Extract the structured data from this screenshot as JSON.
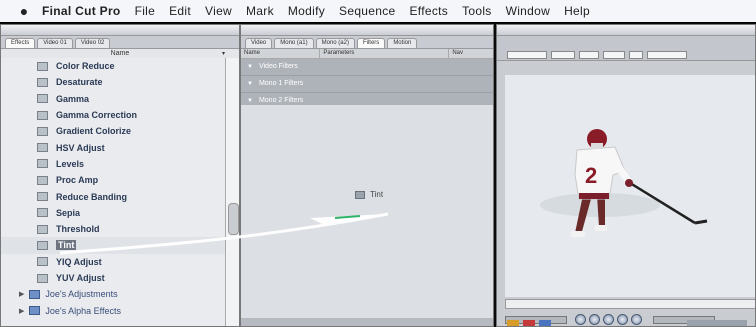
{
  "menubar": {
    "apple": "",
    "items": [
      "Final Cut Pro",
      "File",
      "Edit",
      "View",
      "Mark",
      "Modify",
      "Sequence",
      "Effects",
      "Tools",
      "Window",
      "Help"
    ]
  },
  "browser": {
    "tabs": [
      "Effects",
      "Video 01",
      "Video 02"
    ],
    "column_name": "Name",
    "filters": [
      "Color Reduce",
      "Desaturate",
      "Gamma",
      "Gamma Correction",
      "Gradient Colorize",
      "HSV Adjust",
      "Levels",
      "Proc Amp",
      "Reduce Banding",
      "Sepia",
      "Threshold",
      "Tint",
      "YIQ Adjust",
      "YUV Adjust"
    ],
    "selected": "Tint",
    "bins": [
      "Joe's Adjustments",
      "Joe's Alpha Effects"
    ]
  },
  "filters_panel": {
    "tabs": [
      "Video",
      "Mono (a1)",
      "Mono (a2)",
      "Filters",
      "Motion"
    ],
    "columns": [
      "Name",
      "Parameters",
      "Nav"
    ],
    "rows": [
      "Video Filters",
      "Mono 1 Filters",
      "Mono 2 Filters"
    ],
    "drag_label": "Tint"
  },
  "viewer": {
    "player_number": "2"
  },
  "colors": {
    "menubar": "#f4f6fa",
    "panel": "#d9dde2",
    "accent_blue": "#6d90c9",
    "selected": "#6d7480"
  }
}
